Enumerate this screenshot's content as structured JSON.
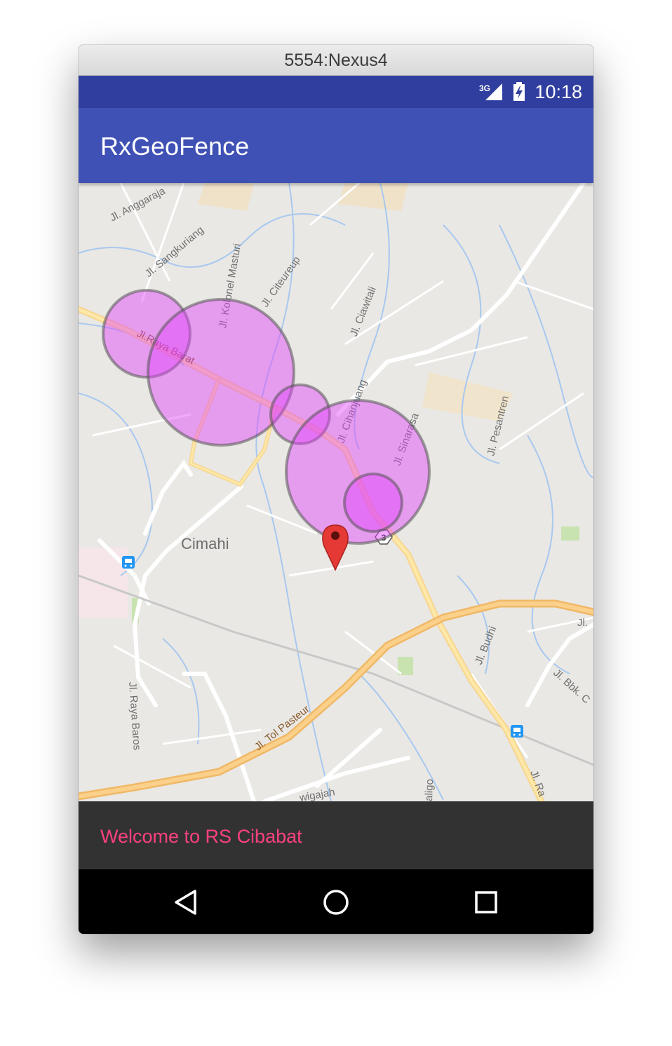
{
  "window": {
    "title": "5554:Nexus4"
  },
  "status_bar": {
    "network_type": "3G",
    "time": "10:18",
    "color": "#303f9f"
  },
  "app_bar": {
    "title": "RxGeoFence",
    "color": "#3f51b5"
  },
  "map": {
    "street_labels": [
      "Jl. Anggaraja",
      "Jl. Sangkuriang",
      "Jl. Kolonel Masturi",
      "Jl. Citeureup",
      "Jl. Ciawitali",
      "Jl.Raya Barat",
      "Jl. Cihanjuang",
      "Jl. Sinarasa",
      "Jl. Pesantren",
      "Cimahi",
      "Jl. Budhi",
      "Jl. Bbk. C",
      "Jl.",
      "Jl. Raya Baros",
      "Jl. Tol Pasteur",
      "wigajah",
      "aligo",
      "Jl. Ra"
    ],
    "route_shield": "3",
    "geofence_color": "#e040fb",
    "marker_color": "#e53935"
  },
  "snackbar": {
    "message": "Welcome to RS Cibabat",
    "text_color": "#ff4081"
  },
  "nav_bar": {
    "back_icon": "back-triangle-icon",
    "home_icon": "home-circle-icon",
    "recents_icon": "recents-square-icon"
  }
}
